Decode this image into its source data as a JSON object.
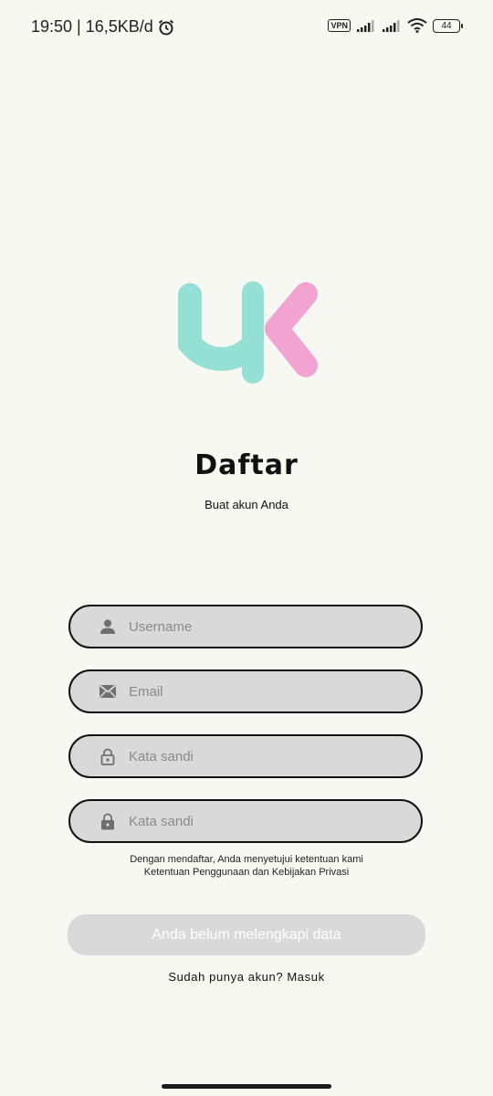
{
  "status_bar": {
    "time_speed": "19:50 | 16,5KB/d",
    "vpn": "VPN",
    "battery": "44",
    "icons": [
      "alarm-icon",
      "signal-icon",
      "signal-icon",
      "wifi-icon",
      "battery-icon"
    ]
  },
  "brand": {
    "logo_teal": "#94e0d4",
    "logo_pink": "#f3a3d1"
  },
  "header": {
    "title": "Daftar",
    "subtitle": "Buat akun Anda"
  },
  "form": {
    "username": {
      "placeholder": "Username",
      "value": "",
      "icon": "person-icon"
    },
    "email": {
      "placeholder": "Email",
      "value": "",
      "icon": "mail-icon"
    },
    "password": {
      "placeholder": "Kata sandi",
      "value": "",
      "icon": "lock-open-icon"
    },
    "confirm_password": {
      "placeholder": "Kata sandi",
      "value": "",
      "icon": "lock-icon"
    }
  },
  "terms": {
    "line1": "Dengan mendaftar, Anda menyetujui ketentuan kami",
    "line2": "Ketentuan Penggunaan dan Kebijakan Privasi"
  },
  "submit_label": "Anda belum melengkapi data",
  "login_link": "Sudah punya akun? Masuk"
}
